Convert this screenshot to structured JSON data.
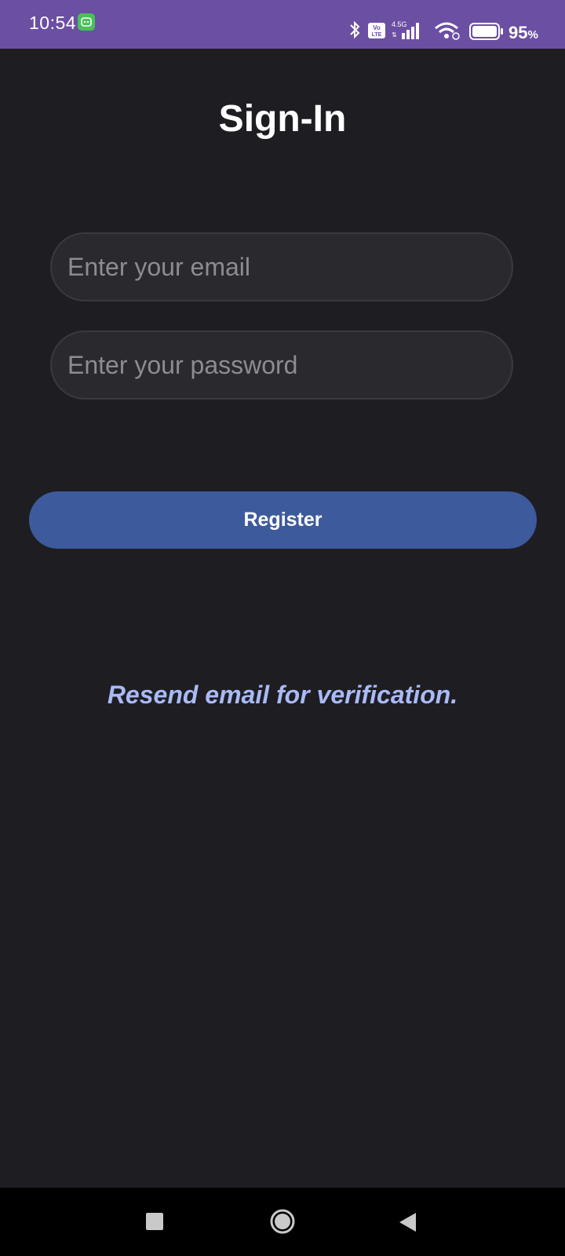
{
  "status_bar": {
    "time": "10:54",
    "network_type": "4.5G",
    "battery_value": "95",
    "battery_unit": "%",
    "icons": [
      "app-notification-icon",
      "bluetooth-icon",
      "volte-icon",
      "signal-icon",
      "wifi-icon",
      "battery-icon"
    ],
    "background_color": "#6b4fa3"
  },
  "page": {
    "title": "Sign-In",
    "background_color": "#1e1d22"
  },
  "form": {
    "email_placeholder": "Enter your email",
    "email_value": "",
    "password_placeholder": "Enter your password",
    "password_value": "",
    "register_label": "Register",
    "button_color": "#3d5a9c"
  },
  "links": {
    "resend_label": "Resend email for verification.",
    "link_color": "#a9baf5"
  },
  "nav_bar": {
    "icons": [
      "recents-icon",
      "home-icon",
      "back-icon"
    ]
  }
}
